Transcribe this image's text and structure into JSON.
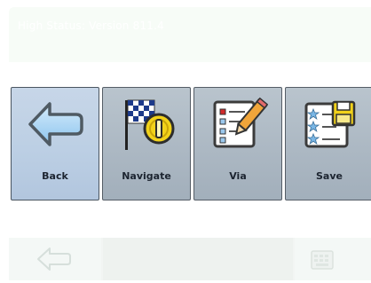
{
  "header": {
    "title": "High Status: Version 811.4"
  },
  "buttons": [
    {
      "id": "back",
      "label": "Back",
      "icon": "arrow-left-icon"
    },
    {
      "id": "navigate",
      "label": "Navigate",
      "icon": "checkered-flag-icon"
    },
    {
      "id": "via",
      "label": "Via",
      "icon": "checklist-pencil-icon"
    },
    {
      "id": "save",
      "label": "Save",
      "icon": "star-list-disk-icon"
    }
  ],
  "bottom_bar": {
    "back_icon": "arrow-left-icon",
    "keyboard_icon": "keyboard-icon"
  },
  "colors": {
    "tile": "#acb8c3",
    "tile_pressed": "#bccfe4",
    "tile_border": "#555d66",
    "label": "#1c2430",
    "arrow_fill": "#9fd0f3",
    "flag_yellow": "#f2d21a"
  }
}
